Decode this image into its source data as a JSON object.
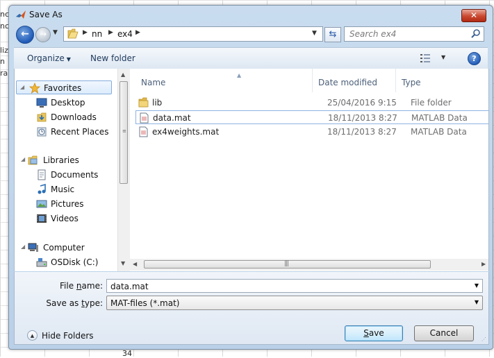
{
  "window": {
    "title": "Save As",
    "close_label": "✕"
  },
  "background": {
    "fragments": [
      "nc",
      "nc",
      "liz",
      "n",
      "ra"
    ],
    "row_number": "34"
  },
  "address": {
    "crumbs": [
      "nn",
      "ex4"
    ]
  },
  "search": {
    "placeholder": "Search ex4"
  },
  "toolbar": {
    "organize": "Organize",
    "new_folder": "New folder",
    "help": "?"
  },
  "nav": {
    "favorites": {
      "label": "Favorites",
      "items": [
        "Desktop",
        "Downloads",
        "Recent Places"
      ]
    },
    "libraries": {
      "label": "Libraries",
      "items": [
        "Documents",
        "Music",
        "Pictures",
        "Videos"
      ]
    },
    "computer": {
      "label": "Computer",
      "items": [
        "OSDisk (C:)"
      ]
    }
  },
  "columns": {
    "name": "Name",
    "date": "Date modified",
    "type": "Type"
  },
  "files": [
    {
      "name": "lib",
      "date": "25/04/2016 9:15",
      "type": "File folder",
      "icon": "folder-icon"
    },
    {
      "name": "data.mat",
      "date": "18/11/2013 8:27",
      "type": "MATLAB Data",
      "icon": "mat-file-icon"
    },
    {
      "name": "ex4weights.mat",
      "date": "18/11/2013 8:27",
      "type": "MATLAB Data",
      "icon": "mat-file-icon"
    }
  ],
  "form": {
    "file_name_label_a": "File ",
    "file_name_label_u": "n",
    "file_name_label_b": "ame:",
    "file_name_value": "data.mat",
    "save_type_label_a": "Save as ",
    "save_type_label_u": "t",
    "save_type_label_b": "ype:",
    "save_type_value": "MAT-files (*.mat)"
  },
  "footer": {
    "hide_folders": "Hide Folders",
    "save_u": "S",
    "save_rest": "ave",
    "cancel": "Cancel"
  }
}
